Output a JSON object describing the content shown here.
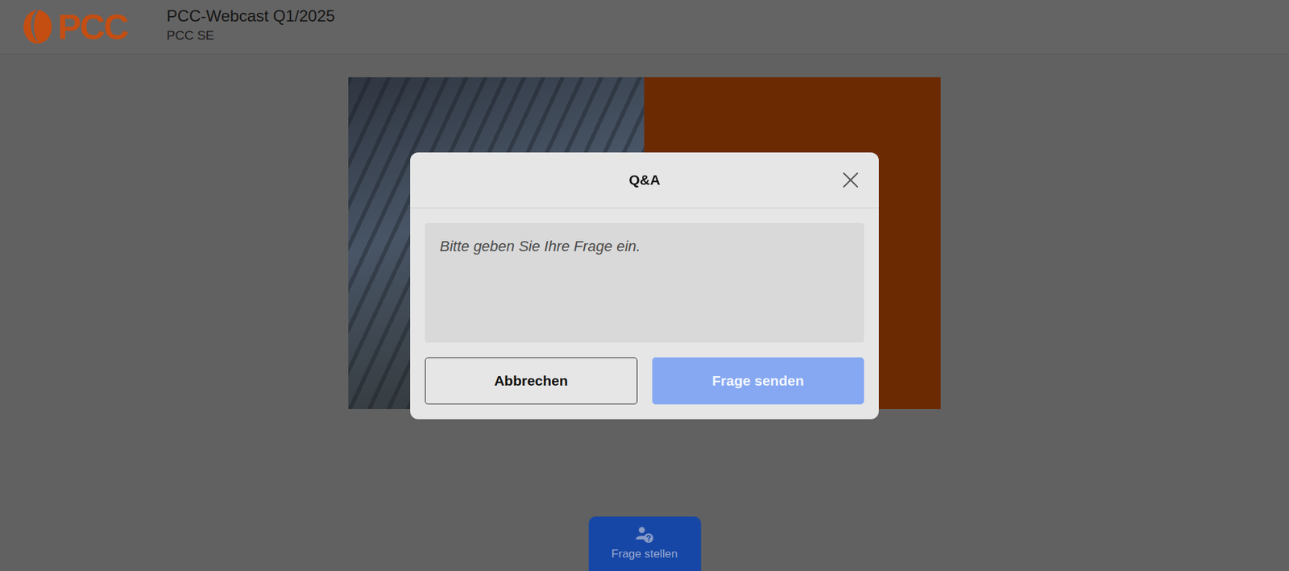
{
  "header": {
    "logo": "PCC",
    "title": "PCC-Webcast Q1/2025",
    "subtitle": "PCC SE"
  },
  "modal": {
    "title": "Q&A",
    "placeholder": "Bitte geben Sie Ihre Frage ein.",
    "buttons": [
      {
        "label": "Abbrechen",
        "kind": "secondary",
        "disabled": false
      },
      {
        "label": "Frage senden",
        "kind": "primary",
        "disabled": true
      }
    ]
  },
  "ask_button": {
    "label": "Frage stellen"
  }
}
